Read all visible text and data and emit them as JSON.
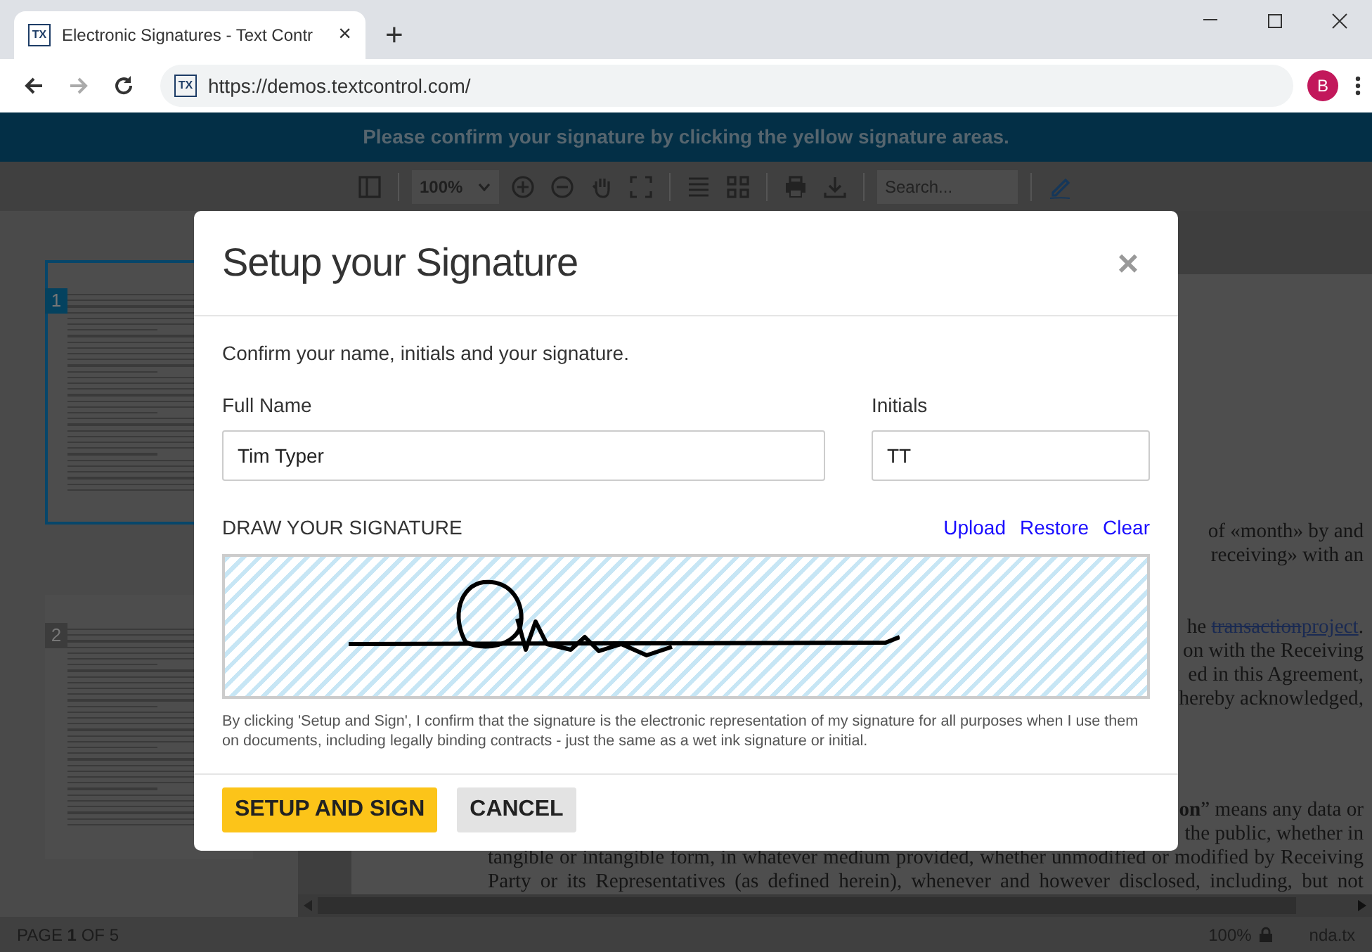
{
  "browser": {
    "tab": {
      "favicon": "TX",
      "title": "Electronic Signatures - Text Contr",
      "close": "×"
    },
    "new_tab": "+",
    "url_favicon": "TX",
    "url": "https://demos.textcontrol.com/",
    "avatar": "B"
  },
  "banner": "Please confirm your signature by clicking the yellow signature areas.",
  "toolbar": {
    "zoom": "100%",
    "search": {
      "placeholder": "Search..."
    }
  },
  "thumbnails": [
    {
      "number": "1",
      "selected": true
    },
    {
      "number": "2",
      "selected": false
    }
  ],
  "document": {
    "blocks": [
      [
        {
          "kind": "fragment",
          "parts": [
            {
              "kind": "plain",
              "text": "of «month» by and"
            }
          ]
        },
        {
          "kind": "fragment",
          "parts": [
            {
              "kind": "plain",
              "text": "receiving» with an"
            }
          ]
        }
      ],
      [
        {
          "kind": "fragment",
          "parts": [
            {
              "kind": "plain",
              "text": "he "
            },
            {
              "kind": "deleted",
              "text": "transaction"
            },
            {
              "kind": "inserted",
              "text": "project"
            },
            {
              "kind": "plain",
              "text": "."
            }
          ]
        },
        {
          "kind": "fragment",
          "parts": [
            {
              "kind": "plain",
              "text": "on with the Receiving"
            }
          ]
        },
        {
          "kind": "fragment",
          "parts": [
            {
              "kind": "plain",
              "text": "ed in this Agreement,"
            }
          ]
        },
        {
          "kind": "fragment",
          "parts": [
            {
              "kind": "plain",
              "text": "hereby acknowledged,"
            }
          ]
        }
      ],
      [
        {
          "kind": "fragment",
          "parts": [
            {
              "kind": "bold",
              "text": "on"
            },
            {
              "kind": "plain",
              "text": "” means any data or"
            }
          ]
        },
        {
          "kind": "fragment",
          "parts": [
            {
              "kind": "plain",
              "text": "the public, whether in"
            }
          ]
        },
        {
          "kind": "full",
          "parts": [
            {
              "kind": "plain",
              "text": "tangible or intangible form, in whatever medium provided, whether unmodified or modified by Receiving"
            }
          ]
        },
        {
          "kind": "full",
          "parts": [
            {
              "kind": "plain",
              "text": "Party or its Representatives (as defined herein), whenever and however disclosed, including, but not"
            }
          ]
        }
      ]
    ]
  },
  "status_bar": {
    "page": "PAGE **1** OF 5",
    "zoom": "100%",
    "file": "nda.tx"
  },
  "dialog": {
    "title": "Setup your Signature",
    "close": "×",
    "intro": "Confirm your name, initials and your signature.",
    "fields": [
      {
        "label": "Full Name",
        "value": "Tim Typer"
      },
      {
        "label": "Initials",
        "value": "TT"
      }
    ],
    "signature_label": "DRAW YOUR SIGNATURE",
    "signature_links": [
      "Upload",
      "Restore",
      "Clear"
    ],
    "disclaimer": "By clicking 'Setup and Sign', I confirm that the signature is the electronic representation of my signature for all purposes when I use them on documents, including legally binding contracts - just the same as a wet ink signature or initial.",
    "buttons": [
      {
        "kind": "primary",
        "label": "SETUP AND SIGN"
      },
      {
        "kind": "secondary",
        "label": "CANCEL"
      }
    ]
  }
}
